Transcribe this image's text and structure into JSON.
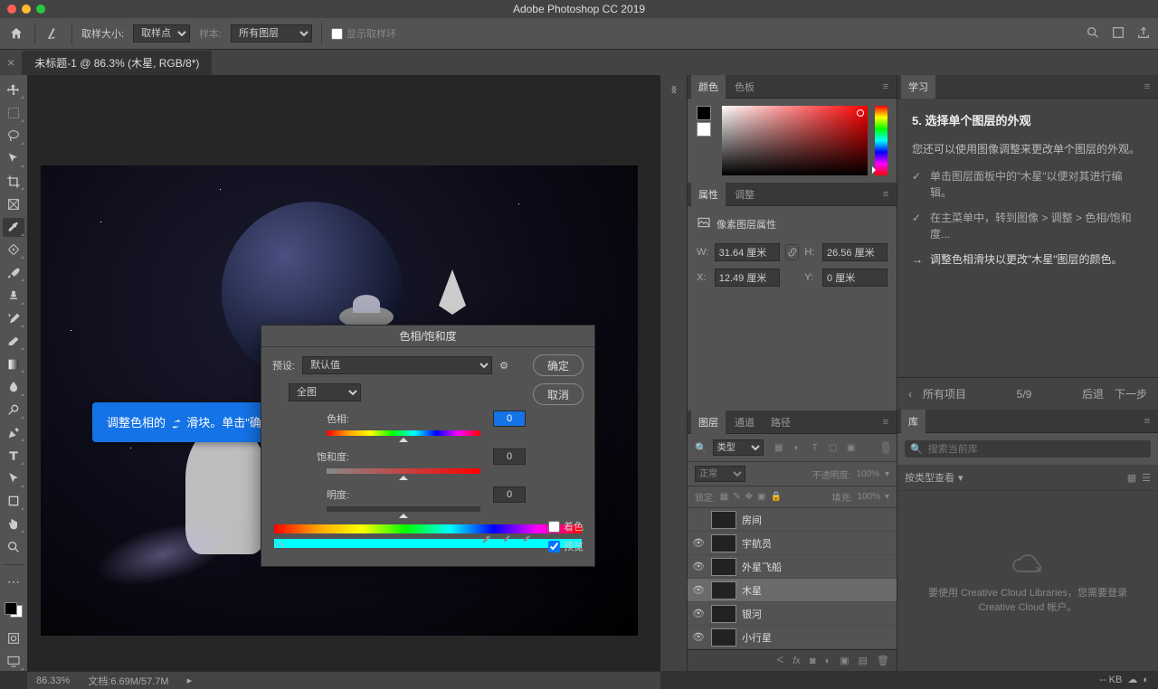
{
  "app": {
    "title": "Adobe Photoshop CC 2019"
  },
  "options_bar": {
    "sample_size_label": "取样大小:",
    "sample_size_value": "取样点",
    "sample_label": "样本:",
    "sample_value": "所有图层",
    "show_ring_label": "显示取样环"
  },
  "document": {
    "tab_title": "未标题-1 @ 86.3% (木星, RGB/8*)"
  },
  "status": {
    "zoom": "86.33%",
    "doc_info": "文档:6.69M/57.7M",
    "sync": "-- KB"
  },
  "tooltip": {
    "text_before": "调整色相的 ",
    "text_after": " 滑块。单击\"确定\"。"
  },
  "dialog": {
    "title": "色相/饱和度",
    "preset_label": "预设:",
    "preset_value": "默认值",
    "channel_value": "全图",
    "sliders": {
      "hue_label": "色相:",
      "hue_value": "0",
      "saturation_label": "饱和度:",
      "saturation_value": "0",
      "lightness_label": "明度:",
      "lightness_value": "0"
    },
    "colorize_label": "着色",
    "preview_label": "预览",
    "ok": "确定",
    "cancel": "取消"
  },
  "panels": {
    "color_tab": "颜色",
    "swatches_tab": "色板",
    "properties_tab": "属性",
    "adjustments_tab": "调整",
    "properties": {
      "title": "像素图层属性",
      "w_label": "W:",
      "w_value": "31.64 厘米",
      "h_label": "H:",
      "h_value": "26.56 厘米",
      "x_label": "X:",
      "x_value": "12.49 厘米",
      "y_label": "Y:",
      "y_value": "0 厘米"
    },
    "layers_tab": "图层",
    "channels_tab": "通道",
    "paths_tab": "路径",
    "layers": {
      "filter_kind": "类型",
      "blend_mode": "正常",
      "opacity_label": "不透明度:",
      "opacity_value": "100%",
      "lock_label": "锁定:",
      "fill_label": "填充:",
      "fill_value": "100%",
      "items": [
        {
          "name": "房间",
          "visible": false
        },
        {
          "name": "宇航员",
          "visible": true
        },
        {
          "name": "外星飞船",
          "visible": true
        },
        {
          "name": "木星",
          "visible": true,
          "selected": true
        },
        {
          "name": "银河",
          "visible": true
        },
        {
          "name": "小行星",
          "visible": true
        }
      ]
    },
    "learn_tab": "学习",
    "learn": {
      "step_title": "5.  选择单个图层的外观",
      "intro": "您还可以使用图像调整来更改单个图层的外观。",
      "steps": [
        {
          "done": true,
          "text": "单击图层面板中的\"木星\"以便对其进行编辑。"
        },
        {
          "done": true,
          "text": "在主菜单中，转到图像 > 调整 > 色相/饱和度..."
        },
        {
          "done": false,
          "text": "调整色相滑块以更改\"木星\"图层的颜色。"
        }
      ],
      "all_items": "所有项目",
      "progress": "5/9",
      "back": "后退",
      "next": "下一步"
    },
    "libraries_tab": "库",
    "libraries": {
      "search_placeholder": "搜索当前库",
      "sort_label": "按类型查看",
      "empty_text": "要使用 Creative Cloud Libraries，您需要登录 Creative Cloud 帐户。"
    }
  }
}
